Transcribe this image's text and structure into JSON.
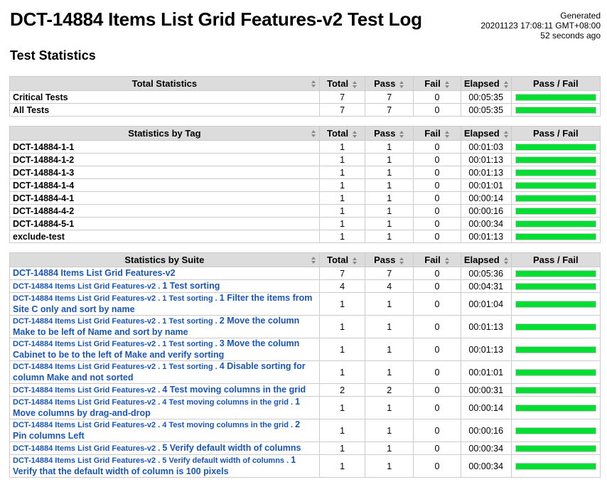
{
  "page": {
    "title": "DCT-14884 Items List Grid Features-v2 Test Log",
    "generated_label": "Generated",
    "generated_time": "20201123 17:08:11 GMT+08:00",
    "generated_ago": "52 seconds ago",
    "section_title": "Test Statistics"
  },
  "columns": {
    "total": "Total",
    "pass": "Pass",
    "fail": "Fail",
    "elapsed": "Elapsed",
    "passfail": "Pass / Fail"
  },
  "colors": {
    "pass_bar": "#00dd33",
    "link": "#1a56b8",
    "header_bg": "#dcdcdc"
  },
  "total_statistics": {
    "header": "Total Statistics",
    "rows": [
      {
        "name": "Critical Tests",
        "total": "7",
        "pass": "7",
        "fail": "0",
        "elapsed": "00:05:35",
        "pass_ratio": 1.0
      },
      {
        "name": "All Tests",
        "total": "7",
        "pass": "7",
        "fail": "0",
        "elapsed": "00:05:35",
        "pass_ratio": 1.0
      }
    ]
  },
  "tag_statistics": {
    "header": "Statistics by Tag",
    "rows": [
      {
        "name": "DCT-14884-1-1",
        "total": "1",
        "pass": "1",
        "fail": "0",
        "elapsed": "00:01:03",
        "pass_ratio": 1.0
      },
      {
        "name": "DCT-14884-1-2",
        "total": "1",
        "pass": "1",
        "fail": "0",
        "elapsed": "00:01:13",
        "pass_ratio": 1.0
      },
      {
        "name": "DCT-14884-1-3",
        "total": "1",
        "pass": "1",
        "fail": "0",
        "elapsed": "00:01:13",
        "pass_ratio": 1.0
      },
      {
        "name": "DCT-14884-1-4",
        "total": "1",
        "pass": "1",
        "fail": "0",
        "elapsed": "00:01:01",
        "pass_ratio": 1.0
      },
      {
        "name": "DCT-14884-4-1",
        "total": "1",
        "pass": "1",
        "fail": "0",
        "elapsed": "00:00:14",
        "pass_ratio": 1.0
      },
      {
        "name": "DCT-14884-4-2",
        "total": "1",
        "pass": "1",
        "fail": "0",
        "elapsed": "00:00:16",
        "pass_ratio": 1.0
      },
      {
        "name": "DCT-14884-5-1",
        "total": "1",
        "pass": "1",
        "fail": "0",
        "elapsed": "00:00:34",
        "pass_ratio": 1.0
      },
      {
        "name": "exclude-test",
        "total": "1",
        "pass": "1",
        "fail": "0",
        "elapsed": "00:01:13",
        "pass_ratio": 1.0
      }
    ]
  },
  "suite_statistics": {
    "header": "Statistics by Suite",
    "rows": [
      {
        "prefix": "",
        "name": "DCT-14884 Items List Grid Features-v2",
        "total": "7",
        "pass": "7",
        "fail": "0",
        "elapsed": "00:05:36",
        "pass_ratio": 1.0
      },
      {
        "prefix": "DCT-14884 Items List Grid Features-v2 . ",
        "name": "1 Test sorting",
        "total": "4",
        "pass": "4",
        "fail": "0",
        "elapsed": "00:04:31",
        "pass_ratio": 1.0
      },
      {
        "prefix": "DCT-14884 Items List Grid Features-v2 . 1 Test sorting . ",
        "name": "1 Filter the items from Site C only and sort by name",
        "total": "1",
        "pass": "1",
        "fail": "0",
        "elapsed": "00:01:04",
        "pass_ratio": 1.0
      },
      {
        "prefix": "DCT-14884 Items List Grid Features-v2 . 1 Test sorting . ",
        "name": "2 Move the column Make to be left of Name and sort by name",
        "total": "1",
        "pass": "1",
        "fail": "0",
        "elapsed": "00:01:13",
        "pass_ratio": 1.0
      },
      {
        "prefix": "DCT-14884 Items List Grid Features-v2 . 1 Test sorting . ",
        "name": "3 Move the column Cabinet to be to the left of Make and verify sorting",
        "total": "1",
        "pass": "1",
        "fail": "0",
        "elapsed": "00:01:13",
        "pass_ratio": 1.0
      },
      {
        "prefix": "DCT-14884 Items List Grid Features-v2 . 1 Test sorting . ",
        "name": "4 Disable sorting for column Make and not sorted",
        "total": "1",
        "pass": "1",
        "fail": "0",
        "elapsed": "00:01:01",
        "pass_ratio": 1.0
      },
      {
        "prefix": "DCT-14884 Items List Grid Features-v2 . ",
        "name": "4 Test moving columns in the grid",
        "total": "2",
        "pass": "2",
        "fail": "0",
        "elapsed": "00:00:31",
        "pass_ratio": 1.0
      },
      {
        "prefix": "DCT-14884 Items List Grid Features-v2 . 4 Test moving columns in the grid . ",
        "name": "1 Move columns by drag-and-drop",
        "total": "1",
        "pass": "1",
        "fail": "0",
        "elapsed": "00:00:14",
        "pass_ratio": 1.0
      },
      {
        "prefix": "DCT-14884 Items List Grid Features-v2 . 4 Test moving columns in the grid . ",
        "name": "2 Pin columns Left",
        "total": "1",
        "pass": "1",
        "fail": "0",
        "elapsed": "00:00:16",
        "pass_ratio": 1.0
      },
      {
        "prefix": "DCT-14884 Items List Grid Features-v2 . ",
        "name": "5 Verify default width of columns",
        "total": "1",
        "pass": "1",
        "fail": "0",
        "elapsed": "00:00:34",
        "pass_ratio": 1.0
      },
      {
        "prefix": "DCT-14884 Items List Grid Features-v2 . 5 Verify default width of columns . ",
        "name": "1 Verify that the default width of column is 100 pixels",
        "total": "1",
        "pass": "1",
        "fail": "0",
        "elapsed": "00:00:34",
        "pass_ratio": 1.0
      }
    ]
  }
}
